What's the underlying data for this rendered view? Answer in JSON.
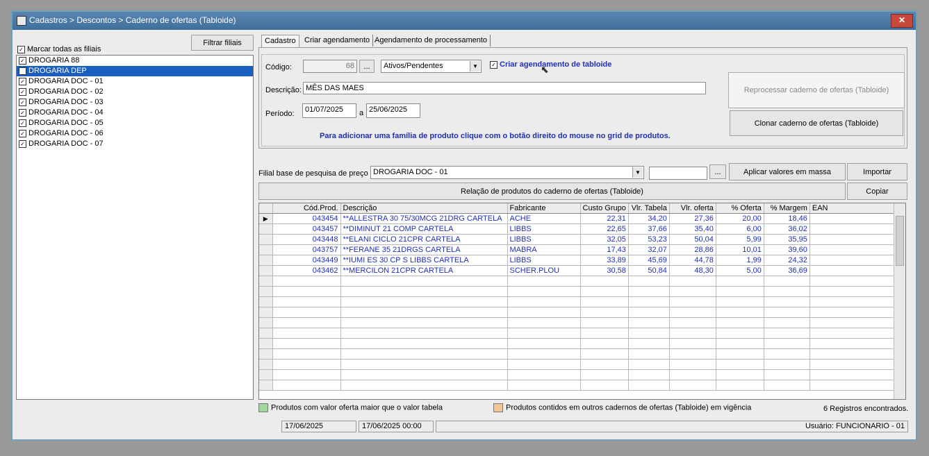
{
  "window": {
    "title": "Cadastros > Descontos > Caderno de ofertas (Tabloide)",
    "close_label": "✕"
  },
  "branches": {
    "filter_button": "Filtrar filiais",
    "select_all_label": "Marcar todas as filiais",
    "items": [
      {
        "label": "DROGARIA 88",
        "selected": false
      },
      {
        "label": "DROGARIA DEP",
        "selected": true
      },
      {
        "label": "DROGARIA DOC - 01",
        "selected": false
      },
      {
        "label": "DROGARIA DOC - 02",
        "selected": false
      },
      {
        "label": "DROGARIA DOC - 03",
        "selected": false
      },
      {
        "label": "DROGARIA DOC - 04",
        "selected": false
      },
      {
        "label": "DROGARIA DOC - 05",
        "selected": false
      },
      {
        "label": "DROGARIA DOC - 06",
        "selected": false
      },
      {
        "label": "DROGARIA DOC - 07",
        "selected": false
      }
    ]
  },
  "tabs": [
    "Cadastro",
    "Criar agendamento",
    "Agendamento de processamento"
  ],
  "form": {
    "codigo_label": "Código:",
    "codigo_value": "68",
    "ellipsis": "...",
    "status_value": "Ativos/Pendentes",
    "criar_agendamento_label": "Criar agendamento de tabloide",
    "descricao_label": "Descrição:",
    "descricao_value": "MÊS DAS MAES",
    "periodo_label": "Período:",
    "periodo_inicio": "01/07/2025",
    "periodo_sep": "a",
    "periodo_fim": "25/06/2025",
    "hint": "Para adicionar uma família de produto clique com o botão direito do  mouse no grid de produtos.",
    "reprocess_button": "Reprocessar caderno de ofertas (Tabloide)",
    "clone_button": "Clonar caderno de ofertas (Tabloide)"
  },
  "pricing": {
    "filial_label": "Filial base de pesquisa de preço",
    "filial_value": "DROGARIA DOC - 01",
    "ellipsis": "...",
    "apply_button": "Aplicar valores em massa",
    "import_button": "Importar",
    "relation_button": "Relação de produtos do caderno de ofertas (Tabloide)",
    "copy_button": "Copiar"
  },
  "grid": {
    "columns": [
      "Cód.Prod.",
      "Descrição",
      "Fabricante",
      "Custo Grupo",
      "Vlr. Tabela",
      "Vlr. oferta",
      "% Oferta",
      "% Margem",
      "EAN"
    ],
    "rows": [
      [
        "043454",
        "**ALLESTRA 30 75/30MCG 21DRG CARTELA",
        "ACHE",
        "22,31",
        "34,20",
        "27,36",
        "20,00",
        "18,46",
        ""
      ],
      [
        "043457",
        "**DIMINUT 21 COMP CARTELA",
        "LIBBS",
        "22,65",
        "37,66",
        "35,40",
        "6,00",
        "36,02",
        ""
      ],
      [
        "043448",
        "**ELANI CICLO 21CPR CARTELA",
        "LIBBS",
        "32,05",
        "53,23",
        "50,04",
        "5,99",
        "35,95",
        ""
      ],
      [
        "043757",
        "**FERANE 35 21DRGS CARTELA",
        "MABRA",
        "17,43",
        "32,07",
        "28,86",
        "10,01",
        "39,60",
        ""
      ],
      [
        "043449",
        "**IUMI ES 30 CP S LIBBS CARTELA",
        "LIBBS",
        "33,89",
        "45,69",
        "44,78",
        "1,99",
        "24,32",
        ""
      ],
      [
        "043462",
        "**MERCILON 21CPR CARTELA",
        "SCHER.PLOU",
        "30,58",
        "50,84",
        "48,30",
        "5,00",
        "36,69",
        ""
      ]
    ]
  },
  "legend": {
    "green_label": "Produtos com valor oferta maior que o valor tabela",
    "orange_label": "Produtos contidos em outros cadernos de ofertas (Tabloide) em vigência",
    "green_color": "#9ed89e",
    "orange_color": "#f2c49a",
    "records": "6 Registros encontrados."
  },
  "status": {
    "date": "17/06/2025",
    "datetime": "17/06/2025 00:00",
    "user": "Usuário: FUNCIONARIO - 01"
  }
}
